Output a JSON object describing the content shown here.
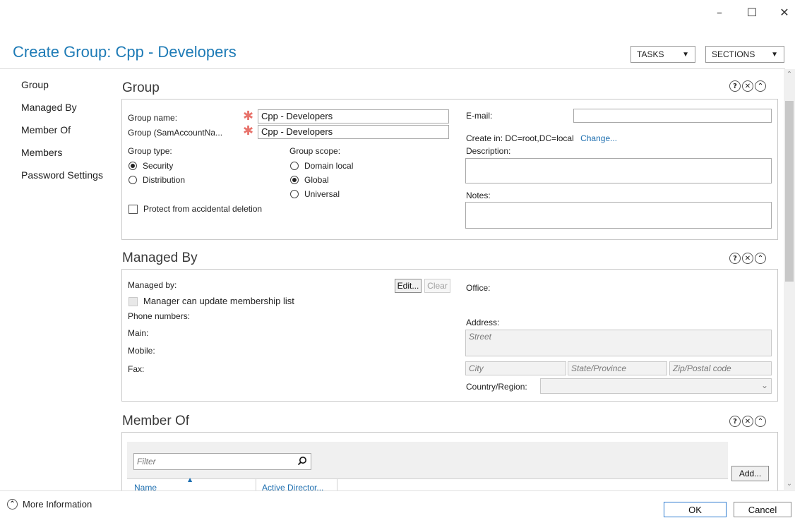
{
  "window": {
    "minimize": "–",
    "maximize": "☐",
    "close": "✕"
  },
  "header": {
    "title": "Create Group: Cpp - Developers",
    "tasks_label": "TASKS",
    "sections_label": "SECTIONS",
    "arrow": "▼"
  },
  "sidebar": {
    "items": [
      {
        "label": "Group"
      },
      {
        "label": "Managed By"
      },
      {
        "label": "Member Of"
      },
      {
        "label": "Members"
      },
      {
        "label": "Password Settings"
      }
    ]
  },
  "section_icons": {
    "help": "?",
    "close": "✕",
    "collapse": "⌃"
  },
  "group": {
    "title": "Group",
    "group_name_label": "Group name:",
    "group_name_value": "Cpp - Developers",
    "sam_label": "Group (SamAccountNa...",
    "sam_value": "Cpp - Developers",
    "required_mark": "✱",
    "group_type_label": "Group type:",
    "type_security": "Security",
    "type_distribution": "Distribution",
    "group_scope_label": "Group scope:",
    "scope_domain_local": "Domain local",
    "scope_global": "Global",
    "scope_universal": "Universal",
    "protect_label": "Protect from accidental deletion",
    "email_label": "E-mail:",
    "email_value": "",
    "create_in_label": "Create in:",
    "create_in_value": "DC=root,DC=local",
    "change_link": "Change...",
    "description_label": "Description:",
    "notes_label": "Notes:"
  },
  "managed_by": {
    "title": "Managed By",
    "managed_by_label": "Managed by:",
    "edit_button": "Edit...",
    "clear_button": "Clear",
    "manager_update_label": "Manager can update membership list",
    "phone_numbers_label": "Phone numbers:",
    "main_label": "Main:",
    "mobile_label": "Mobile:",
    "fax_label": "Fax:",
    "office_label": "Office:",
    "address_label": "Address:",
    "street_placeholder": "Street",
    "city_placeholder": "City",
    "state_placeholder": "State/Province",
    "zip_placeholder": "Zip/Postal code",
    "country_label": "Country/Region:",
    "dropdown_arrow": "⌄"
  },
  "member_of": {
    "title": "Member Of",
    "filter_placeholder": "Filter",
    "add_button": "Add...",
    "columns": [
      "Name",
      "Active Director..."
    ],
    "sort_arrow": "▲"
  },
  "footer": {
    "more_info": "More Information",
    "more_info_icon": "⌃",
    "ok_button": "OK",
    "cancel_button": "Cancel"
  },
  "scrollbar": {
    "up": "⌃",
    "down": "⌄"
  }
}
